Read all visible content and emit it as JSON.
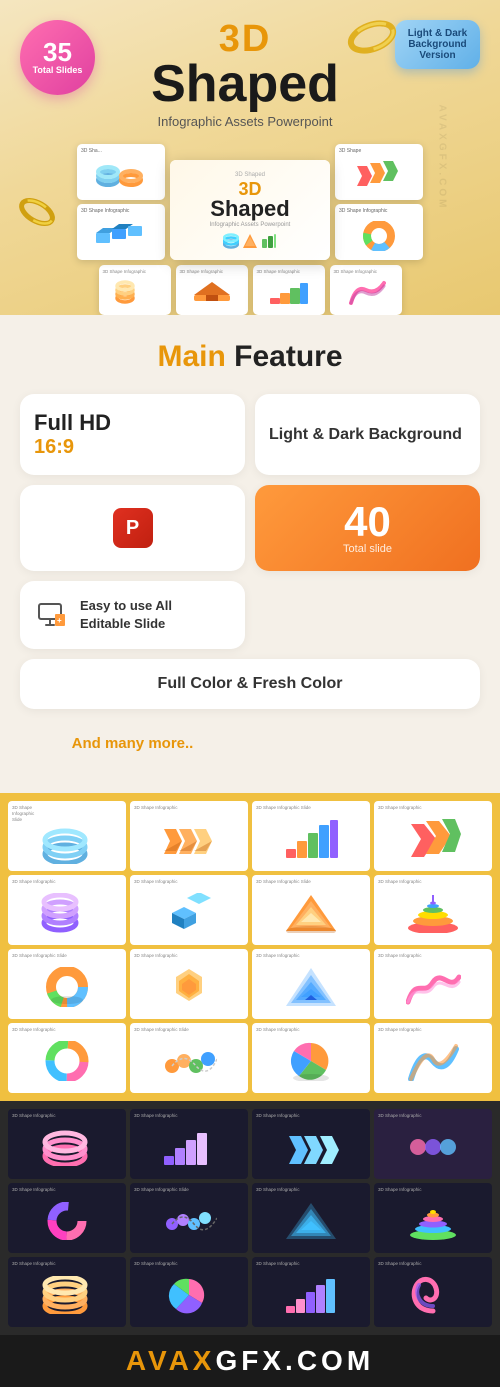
{
  "hero": {
    "badge35": {
      "number": "35",
      "label": "Total Slides"
    },
    "title3d": "3D",
    "titleShaped": "Shaped",
    "subtitle": "Infographic Assets Powerpoint",
    "badgeLightDark": "Light & Dark\nBackground\nVersion"
  },
  "mainFeature": {
    "sectionTitle": "Main Feature",
    "sectionTitleHighlight": "Main",
    "features": [
      {
        "id": "fullhd",
        "label": "Full HD",
        "ratio": "16:9",
        "type": "fullhd"
      },
      {
        "id": "light-dark",
        "label": "Light & Dark Background",
        "type": "text"
      },
      {
        "id": "powerpoint",
        "label": "",
        "type": "ppt"
      },
      {
        "id": "total-slide",
        "count": "40",
        "countLabel": "Total slide",
        "type": "count"
      },
      {
        "id": "editable",
        "label": "Easy to use All\nEditable Slide",
        "type": "editable"
      },
      {
        "id": "full-color",
        "label": "Full Color & Fresh Color",
        "type": "color",
        "fullWidth": true
      },
      {
        "id": "many-more",
        "label": "And many more..",
        "type": "more"
      }
    ]
  },
  "lightSlides": {
    "sectionBg": "#f0c040",
    "slides": [
      {
        "id": 1,
        "shape": "rings",
        "color": "#60c0ff"
      },
      {
        "id": 2,
        "shape": "arrows",
        "color": "#ff9a3c"
      },
      {
        "id": 3,
        "shape": "steps",
        "color": "#40c060"
      },
      {
        "id": 4,
        "shape": "rocket",
        "color": "#ff6060"
      },
      {
        "id": 5,
        "shape": "rings2",
        "color": "#9060ff"
      },
      {
        "id": 6,
        "shape": "cube",
        "color": "#60b0ff"
      },
      {
        "id": 7,
        "shape": "pyramid",
        "color": "#ff9a3c"
      },
      {
        "id": 8,
        "shape": "spiral",
        "color": "#ff6eb0"
      },
      {
        "id": 9,
        "shape": "donut",
        "color": "#60c060"
      },
      {
        "id": 10,
        "shape": "hexagon",
        "color": "#ffb040"
      },
      {
        "id": 11,
        "shape": "triangle",
        "color": "#40a0ff"
      },
      {
        "id": 12,
        "shape": "wave",
        "color": "#ff6060"
      },
      {
        "id": 13,
        "shape": "donut2",
        "color": "#c060ff"
      },
      {
        "id": 14,
        "shape": "balls",
        "color": "#ff9a3c"
      },
      {
        "id": 15,
        "shape": "pie",
        "color": "#40c080"
      },
      {
        "id": 16,
        "shape": "curve",
        "color": "#60c0ff"
      }
    ]
  },
  "darkSlides": {
    "sectionBg": "#2a2a2a",
    "slides": [
      {
        "id": 1,
        "shape": "rings-dark",
        "color": "#ff6eb0"
      },
      {
        "id": 2,
        "shape": "steps-dark",
        "color": "#9060ff"
      },
      {
        "id": 3,
        "shape": "arrows-dark",
        "color": "#60c0ff"
      },
      {
        "id": 4,
        "shape": "placeholder",
        "color": "#444"
      },
      {
        "id": 5,
        "shape": "donut-dark",
        "color": "#ff6eb0"
      },
      {
        "id": 6,
        "shape": "balls-dark",
        "color": "#9060ff"
      },
      {
        "id": 7,
        "shape": "pyramid-dark",
        "color": "#40c0ff"
      },
      {
        "id": 8,
        "shape": "wave-dark",
        "color": "#60e060"
      },
      {
        "id": 9,
        "shape": "rings3",
        "color": "#ff9a3c"
      },
      {
        "id": 10,
        "shape": "donut3",
        "color": "#ff6eb0"
      },
      {
        "id": 11,
        "shape": "steps2",
        "color": "#60c0ff"
      },
      {
        "id": 12,
        "shape": "spiral2",
        "color": "#c060ff"
      }
    ]
  },
  "watermark": {
    "text": "AVAXGFX.COM",
    "bottomText": "AVAX",
    "bottomSub": "GFX.COM"
  }
}
